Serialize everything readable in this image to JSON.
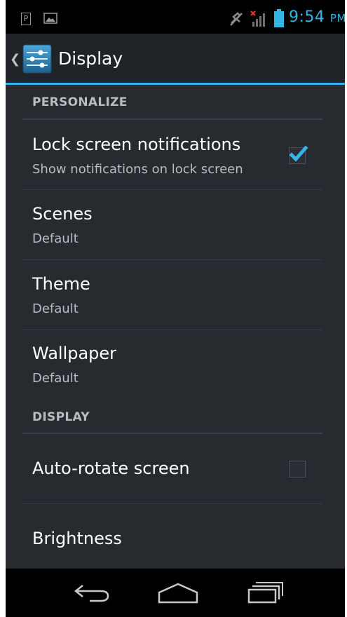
{
  "status_bar": {
    "notif_letter": "P",
    "time": "9:54",
    "ampm": "PM",
    "accent": "#33b5e5"
  },
  "action_bar": {
    "title": "Display",
    "icon": "settings-sliders-icon"
  },
  "sections": {
    "personalize": {
      "header": "PERSONALIZE",
      "items": [
        {
          "title": "Lock screen notifications",
          "summary": "Show notifications on lock screen",
          "checked": true
        },
        {
          "title": "Scenes",
          "summary": "Default"
        },
        {
          "title": "Theme",
          "summary": "Default"
        },
        {
          "title": "Wallpaper",
          "summary": "Default"
        }
      ]
    },
    "display": {
      "header": "DISPLAY",
      "items": [
        {
          "title": "Auto-rotate screen",
          "checked": false
        },
        {
          "title": "Brightness"
        }
      ]
    }
  },
  "nav_bar": {
    "buttons": [
      "back-icon",
      "home-icon",
      "recents-icon"
    ]
  }
}
